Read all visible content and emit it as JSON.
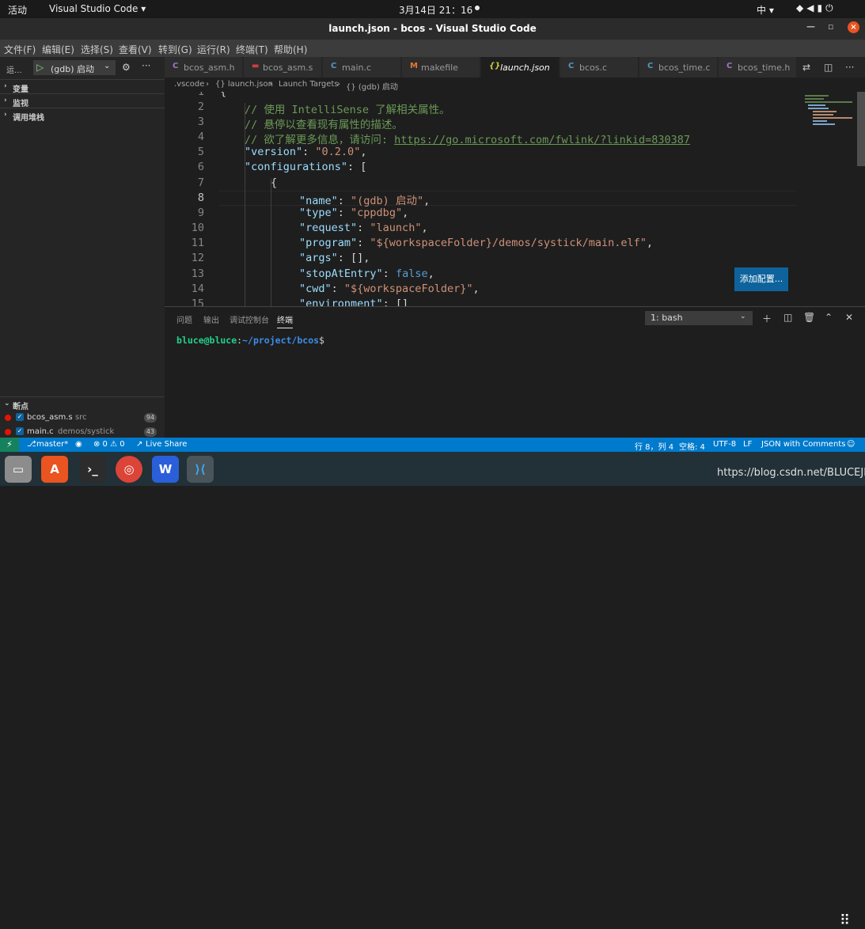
{
  "gnome": {
    "activities": "活动",
    "app_menu": "Visual Studio Code ▾",
    "clock": "3月14日  21：16",
    "ime": "中 ▾",
    "tray_icons": [
      "wifi-icon",
      "volume-icon",
      "battery-icon",
      "power-icon"
    ]
  },
  "window": {
    "title": "launch.json - bcos - Visual Studio Code",
    "close": "×"
  },
  "menu": [
    "文件(F)",
    "编辑(E)",
    "选择(S)",
    "查看(V)",
    "转到(G)",
    "运行(R)",
    "终端(T)",
    "帮助(H)"
  ],
  "sidebar": {
    "header_label": "运...",
    "config_select": "(gdb) 启动",
    "sections": {
      "variables": "变量",
      "watch": "监视",
      "callstack": "调用堆栈",
      "breakpoints": "断点"
    },
    "breakpoints": [
      {
        "file": "bcos_asm.s",
        "dir": "src",
        "count": "94"
      },
      {
        "file": "main.c",
        "dir": "demos/systick",
        "count": "43"
      }
    ]
  },
  "tabs": [
    {
      "icon": "C",
      "label": "bcos_asm.h",
      "color": "#a074c4"
    },
    {
      "icon": "▬",
      "label": "bcos_asm.s",
      "color": "#cc3e44"
    },
    {
      "icon": "C",
      "label": "main.c",
      "color": "#519aba"
    },
    {
      "icon": "M",
      "label": "makefile",
      "color": "#e37933"
    },
    {
      "icon": "{}",
      "label": "launch.json",
      "color": "#cbcb41"
    },
    {
      "icon": "C",
      "label": "bcos.c",
      "color": "#519aba"
    },
    {
      "icon": "C",
      "label": "bcos_time.c",
      "color": "#519aba"
    },
    {
      "icon": "C",
      "label": "bcos_time.h",
      "color": "#a074c4"
    }
  ],
  "breadcrumb": [
    ".vscode",
    "{} launch.json",
    "Launch Targets",
    "{} (gdb) 启动"
  ],
  "editor": {
    "line_numbers": [
      "1",
      "2",
      "3",
      "4",
      "5",
      "6",
      "7",
      "8",
      "9",
      "10",
      "11",
      "12",
      "13",
      "14",
      "15"
    ],
    "current_line": "8",
    "lines": {
      "l1": "{",
      "l2": "// 使用 IntelliSense 了解相关属性。",
      "l3": "// 悬停以查看现有属性的描述。",
      "l4_text": "// 欲了解更多信息，请访问: ",
      "l4_link": "https://go.microsoft.com/fwlink/?linkid=830387",
      "l5_key": "\"version\"",
      "l5_val": "\"0.2.0\"",
      "l6_key": "\"configurations\"",
      "l6_rest": ": [",
      "l7": "{",
      "l8_key": "\"name\"",
      "l8_val": "\"(gdb) 启动\"",
      "l9_key": "\"type\"",
      "l9_val": "\"cppdbg\"",
      "l10_key": "\"request\"",
      "l10_val": "\"launch\"",
      "l11_key": "\"program\"",
      "l11_val": "\"${workspaceFolder}/demos/systick/main.elf\"",
      "l12_key": "\"args\"",
      "l12_rest": ": [],",
      "l13_key": "\"stopAtEntry\"",
      "l13_val": "false",
      "l14_key": "\"cwd\"",
      "l14_val": "\"${workspaceFolder}\"",
      "l15_key": "\"environment\"",
      "l15_rest": ": []"
    },
    "add_config_button": "添加配置..."
  },
  "panel": {
    "tabs": [
      "问题",
      "输出",
      "调试控制台",
      "终端"
    ],
    "active_tab": "终端",
    "terminal_select": "1: bash",
    "prompt_user": "bluce@bluce",
    "prompt_path": "~/project/bcos",
    "prompt_end": "$"
  },
  "statusbar": {
    "branch": "master*",
    "problems": "⊗ 0 ⚠ 0",
    "live_share": "Live Share",
    "position": "行 8，列 4",
    "spaces": "空格: 4",
    "encoding": "UTF-8",
    "eol": "LF",
    "language": "JSON with Comments"
  },
  "dock": [
    "files-icon",
    "software-store-icon",
    "terminal-icon",
    "chrome-icon",
    "wps-icon",
    "vscode-icon"
  ],
  "watermark": "https://blog.csdn.net/BLUCEJIE"
}
